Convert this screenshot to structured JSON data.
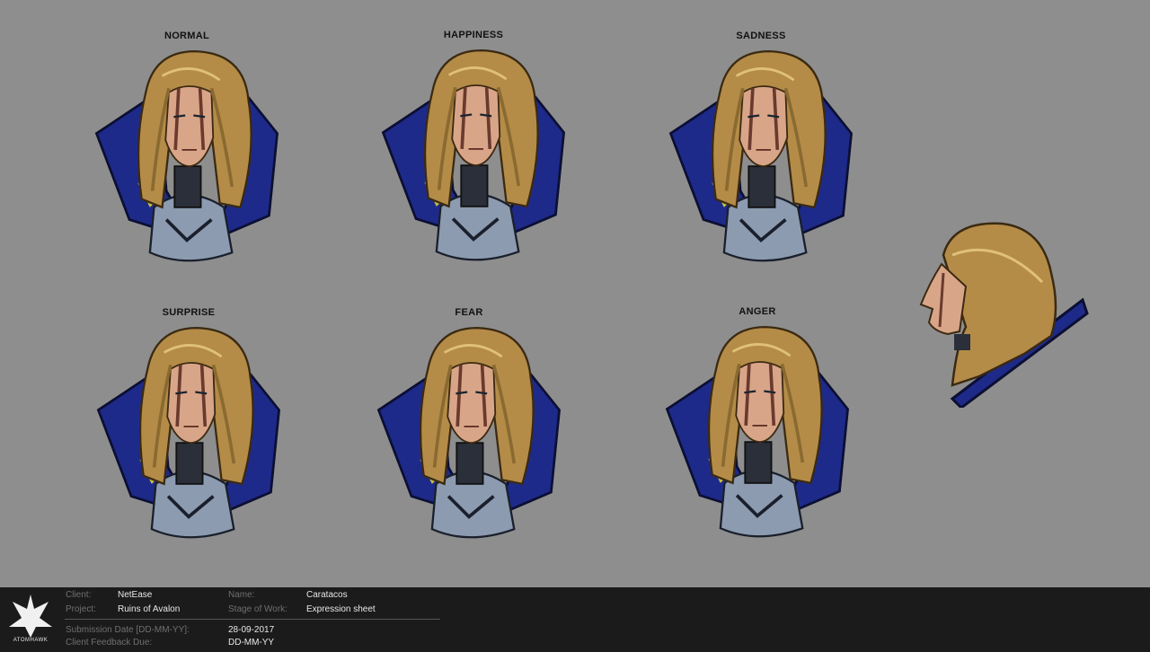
{
  "expressions": [
    {
      "label": "NORMAL"
    },
    {
      "label": "HAPPINESS"
    },
    {
      "label": "SADNESS"
    },
    {
      "label": "SURPRISE"
    },
    {
      "label": "FEAR"
    },
    {
      "label": "ANGER"
    }
  ],
  "footer": {
    "logo_text": "ATOMHAWK",
    "client_label": "Client:",
    "client_value": "NetEase",
    "project_label": "Project:",
    "project_value": "Ruins of Avalon",
    "name_label": "Name:",
    "name_value": "Caratacos",
    "stage_label": "Stage of Work:",
    "stage_value": "Expression sheet",
    "submission_label": "Submission Date [DD-MM-YY]:",
    "submission_value": "28-09-2017",
    "feedback_label": "Client Feedback Due:",
    "feedback_value": "DD-MM-YY"
  },
  "colors": {
    "background": "#8e8e8e",
    "coat": "#1e2a8a",
    "hair": "#c09a55",
    "skin": "#d9a588",
    "armor": "#8c9bb0",
    "footer": "#1b1b1b"
  }
}
